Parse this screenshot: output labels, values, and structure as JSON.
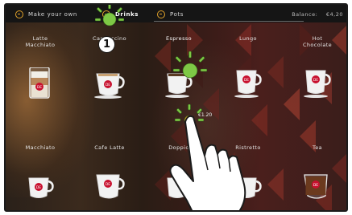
{
  "topbar": {
    "tabs": [
      {
        "label": "Make your own",
        "icon": "cup-icon",
        "active": false
      },
      {
        "label": "Drinks",
        "icon": "cup-icon",
        "active": true
      },
      {
        "label": "Pots",
        "icon": "cup-icon",
        "active": false
      }
    ],
    "balance_label": "Balance:",
    "balance_value": "€4,20"
  },
  "drinks": [
    {
      "label": "Latte\nMacchiato",
      "icon": "latte-macchiato-icon"
    },
    {
      "label": "Cappuccino",
      "icon": "cappuccino-icon"
    },
    {
      "label": "Espresso",
      "icon": "espresso-icon"
    },
    {
      "label": "Lungo",
      "icon": "lungo-icon"
    },
    {
      "label": "Hot\nChocolate",
      "icon": "hot-chocolate-icon"
    },
    {
      "label": "Macchiato",
      "icon": "macchiato-icon"
    },
    {
      "label": "Cafe Latte",
      "icon": "cafe-latte-icon"
    },
    {
      "label": "Doppio",
      "icon": "doppio-icon"
    },
    {
      "label": "Ristretto",
      "icon": "ristretto-icon"
    },
    {
      "label": "Tea",
      "icon": "tea-icon"
    }
  ],
  "espresso_price": "€1.20",
  "step_number": "1",
  "brand_badge": "DE",
  "colors": {
    "accent": "#e2a32a",
    "tap_marker": "#7ec845",
    "badge": "#c8102e",
    "topbar": "#151515"
  }
}
